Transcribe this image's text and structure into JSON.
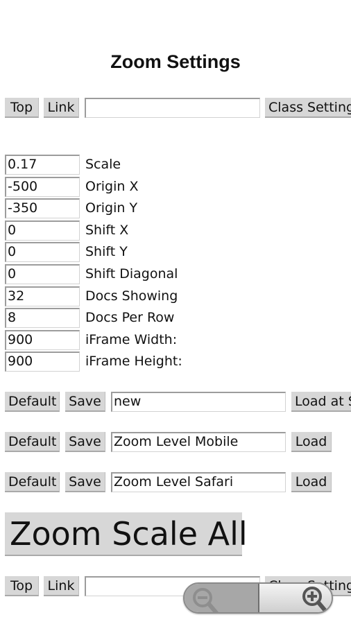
{
  "page": {
    "title": "Zoom Settings"
  },
  "top_nav": {
    "top_label": "Top",
    "link_label": "Link",
    "link_input_value": "",
    "class_settings_label": "Class Settings"
  },
  "fields": [
    {
      "value": "0.17",
      "label": "Scale"
    },
    {
      "value": "-500",
      "label": "Origin X"
    },
    {
      "value": "-350",
      "label": "Origin Y"
    },
    {
      "value": "0",
      "label": "Shift X"
    },
    {
      "value": "0",
      "label": "Shift Y"
    },
    {
      "value": "0",
      "label": "Shift Diagonal"
    },
    {
      "value": "32",
      "label": "Docs Showing"
    },
    {
      "value": "8",
      "label": "Docs Per Row"
    },
    {
      "value": "900",
      "label": "iFrame Width:"
    },
    {
      "value": "900",
      "label": "iFrame Height:"
    }
  ],
  "presets": [
    {
      "default_label": "Default",
      "save_label": "Save",
      "name_value": "new",
      "load_label": "Load at Start"
    },
    {
      "default_label": "Default",
      "save_label": "Save",
      "name_value": "Zoom Level Mobile",
      "load_label": "Load"
    },
    {
      "default_label": "Default",
      "save_label": "Save",
      "name_value": "Zoom Level Safari",
      "load_label": "Load"
    }
  ],
  "zoom_scale_all_label": "Zoom Scale All",
  "bottom_nav": {
    "top_label": "Top",
    "link_label": "Link",
    "link_input_value": "",
    "class_settings_label": "Class Settings"
  },
  "zoom_control": {
    "zoom_out_icon": "zoom-out-icon",
    "zoom_in_icon": "zoom-in-icon"
  }
}
